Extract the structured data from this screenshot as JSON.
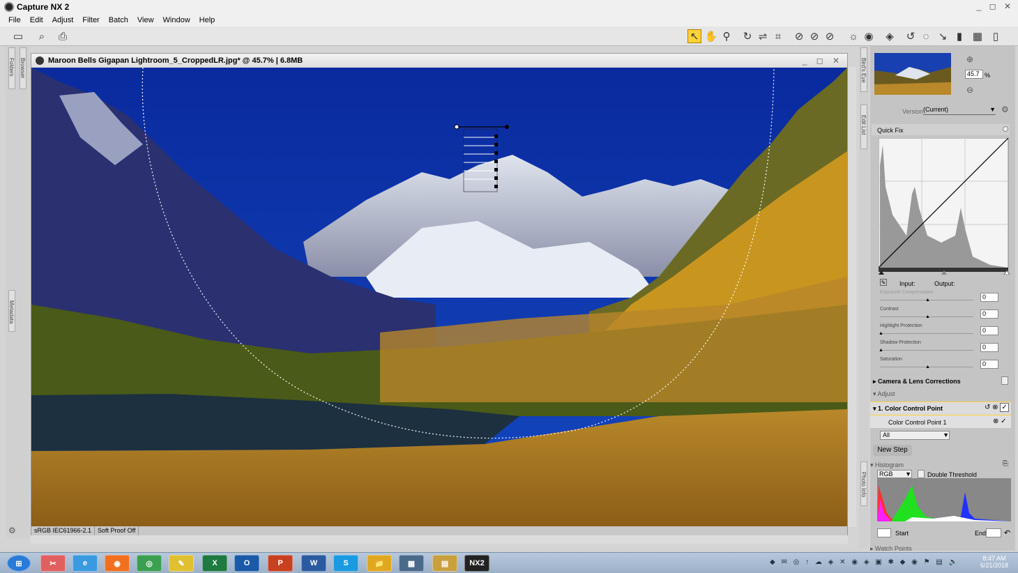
{
  "app": {
    "title": "Capture NX 2",
    "window_controls": "_ ◻ ✕"
  },
  "menu": [
    "File",
    "Edit",
    "Adjust",
    "Filter",
    "Batch",
    "View",
    "Window",
    "Help"
  ],
  "left_tabs": {
    "folders": "Folders",
    "browser": "Browser",
    "metadata": "Metadata"
  },
  "document": {
    "title": "Maroon Bells Gigapan Lightroom_5_CroppedLR.jpg* @ 45.7% | 6.8MB",
    "controls": "_ ◻ ✕",
    "status_profile": "sRGB IEC61966-2.1",
    "status_proof": "Soft Proof Off"
  },
  "right_tabs": {
    "birds_eye": "Bird's Eye",
    "edit_list": "Edit List",
    "photo_info": "Photo Info"
  },
  "birds_eye": {
    "zoom": "45.7",
    "zoom_unit": "%"
  },
  "edit_list": {
    "version_label": "Version",
    "version_value": "(Current)",
    "quick_fix": "Quick Fix",
    "input_label": "Input:",
    "output_label": "Output:",
    "sliders": [
      {
        "label": "Exposure Compensation",
        "min": "-2",
        "max": "2",
        "value": "0",
        "level": 0.5
      },
      {
        "label": "Contrast",
        "min": "-100",
        "max": "100",
        "value": "0",
        "level": 0.5
      },
      {
        "label": "Highlight Protection",
        "min": "0",
        "max": "100",
        "value": "0",
        "level": 0.0
      },
      {
        "label": "Shadow Protection",
        "min": "0",
        "max": "100",
        "value": "0",
        "level": 0.0
      },
      {
        "label": "Saturation",
        "min": "-100",
        "max": "100",
        "value": "0",
        "level": 0.5
      }
    ],
    "camera_lens": "Camera & Lens Corrections",
    "adjust": "Adjust",
    "ccp_step": "1. Color Control Point",
    "ccp_item": "Color Control Point 1",
    "ccp_channel": "All",
    "new_step": "New Step"
  },
  "histogram": {
    "title": "Histogram",
    "channel": "RGB",
    "double_threshold": "Double Threshold",
    "start": "Start",
    "end": "End",
    "watch_points": "Watch Points"
  },
  "taskbar": {
    "apps": [
      "Start",
      "Snipping Tool",
      "Internet Explorer",
      "Firefox",
      "Chrome",
      "Files",
      "Excel",
      "Outlook",
      "PowerPoint",
      "Word",
      "Skype",
      "Explorer",
      "Photos",
      "Screen",
      "Capture NX 2"
    ],
    "app_glyphs": [
      "⊞",
      "✂",
      "e",
      "◉",
      "◎",
      "✎",
      "X",
      "O",
      "P",
      "W",
      "S",
      "📁",
      "▦",
      "▤",
      "NX2"
    ],
    "time": "8:47 AM",
    "date": "6/21/2018"
  },
  "colors": {
    "accent": "#ffd23a",
    "sky": "#0b2fa6",
    "taskbar": "#9cb0c8"
  }
}
